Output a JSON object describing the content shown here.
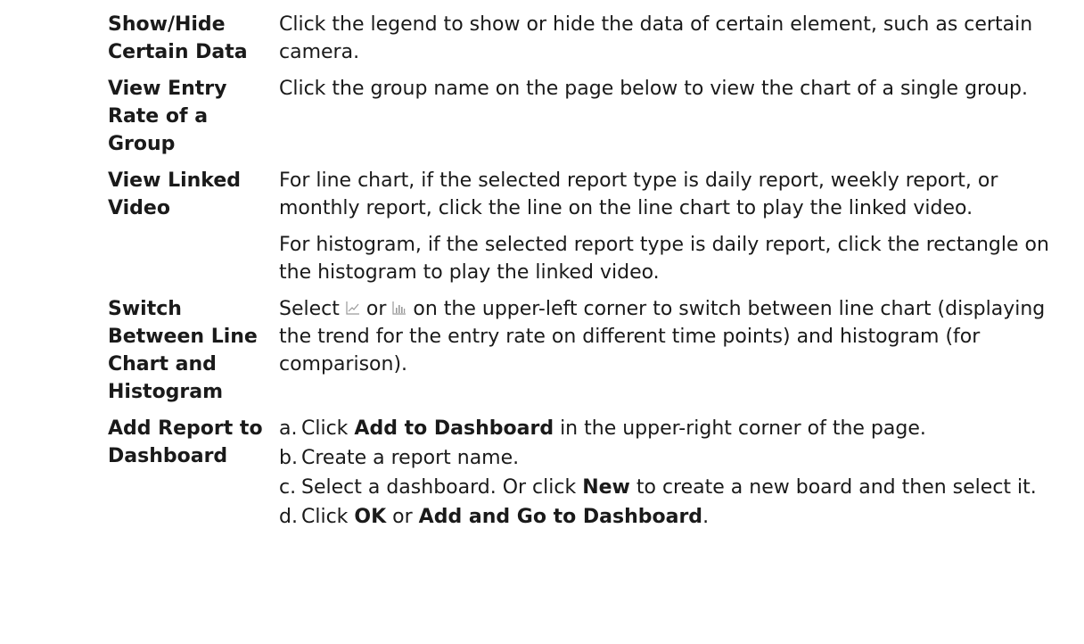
{
  "rows": [
    {
      "term": "Show/Hide Certain Data",
      "desc": "Click the legend to show or hide the data of certain element, such as certain camera."
    },
    {
      "term": "View Entry Rate of a Group",
      "desc": "Click the group name on the page below to view the chart of a single group."
    },
    {
      "term": "View Linked Video",
      "desc_1": "For line chart, if the selected report type is daily report, weekly report, or monthly report, click the line on the line chart to play the linked video.",
      "desc_2": "For histogram, if the selected report type is daily report, click the rectangle on the histogram to play the linked video."
    },
    {
      "term": "Switch Between Line Chart and Histogram",
      "select": "Select",
      "or": "or",
      "desc_rest": "on the upper-left corner to switch between line chart (displaying the trend for the entry rate on different time points) and histogram (for comparison).",
      "icon_1": "line-chart-icon",
      "icon_2": "histogram-icon"
    },
    {
      "term": "Add Report to Dashboard",
      "steps": [
        {
          "marker": "a.",
          "pre": "Click ",
          "bold": "Add to Dashboard",
          "post": " in the upper-right corner of the page."
        },
        {
          "marker": "b.",
          "pre": "Create a report name.",
          "bold": "",
          "post": ""
        },
        {
          "marker": "c.",
          "pre": "Select a dashboard. Or click ",
          "bold": "New",
          "post": " to create a new board and then select it."
        },
        {
          "marker": "d.",
          "pre": "Click ",
          "bold": "OK",
          "mid": " or ",
          "bold2": "Add and Go to Dashboard",
          "post": "."
        }
      ]
    }
  ]
}
